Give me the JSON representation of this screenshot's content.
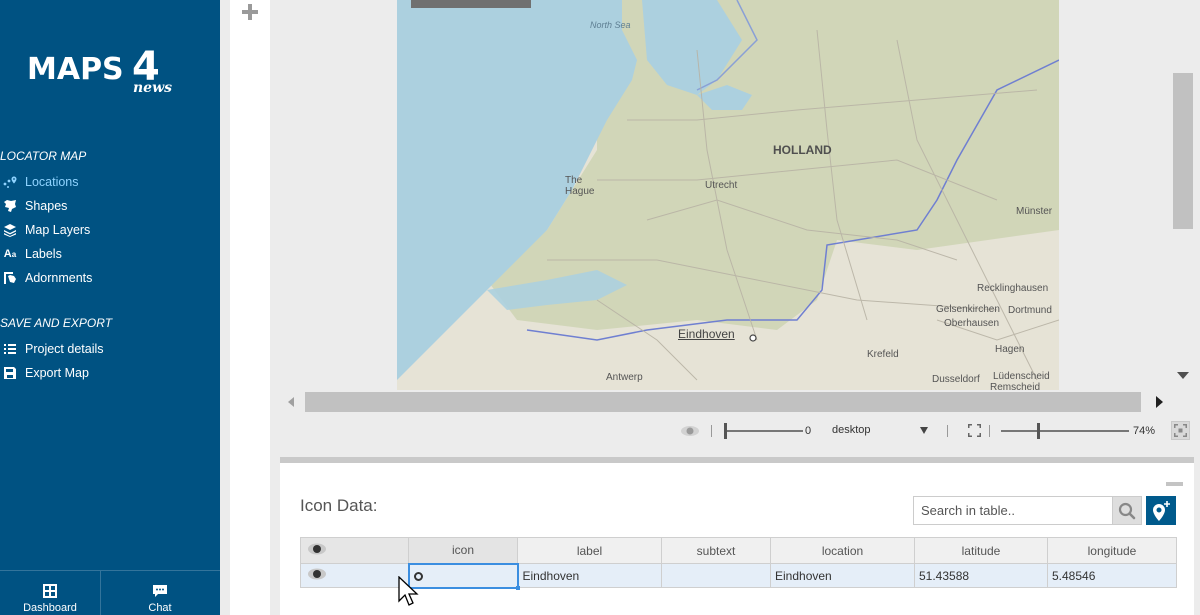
{
  "brand": {
    "main": "MAPS",
    "four": "4",
    "sub": "news"
  },
  "sidebar": {
    "sections": [
      {
        "title": "LOCATOR MAP",
        "items": [
          {
            "label": "Locations",
            "icon": "locations-icon",
            "active": true
          },
          {
            "label": "Shapes",
            "icon": "shapes-icon"
          },
          {
            "label": "Map Layers",
            "icon": "layers-icon"
          },
          {
            "label": "Labels",
            "icon": "labels-icon"
          },
          {
            "label": "Adornments",
            "icon": "adornments-icon"
          }
        ]
      },
      {
        "title": "SAVE AND EXPORT",
        "items": [
          {
            "label": "Project details",
            "icon": "list-icon"
          },
          {
            "label": "Export Map",
            "icon": "save-icon"
          }
        ]
      }
    ],
    "bottom": [
      {
        "label": "Dashboard",
        "icon": "dashboard-icon"
      },
      {
        "label": "Chat",
        "icon": "chat-icon"
      }
    ]
  },
  "map": {
    "labels": {
      "north_sea": "North Sea",
      "holland": "HOLLAND",
      "the": "The",
      "hague": "Hague",
      "utrecht": "Utrecht",
      "munster": "Münster",
      "recklinghausen": "Recklinghausen",
      "gelsenkirchen": "Gelsenkirchen",
      "dortmund": "Dortmund",
      "oberhausen": "Oberhausen",
      "eindhoven": "Eindhoven",
      "krefeld": "Krefeld",
      "hagen": "Hagen",
      "antwerp": "Antwerp",
      "dusseldorf": "Dusseldorf",
      "ludenscheid": "Lüdenscheid",
      "remscheid": "Remscheid"
    }
  },
  "toolbar": {
    "slider_value": "0",
    "device": "desktop",
    "zoom": "74%"
  },
  "panel": {
    "title": "Icon Data:",
    "search_placeholder": "Search in table..",
    "columns": [
      "icon",
      "label",
      "subtext",
      "location",
      "latitude",
      "longitude"
    ],
    "rows": [
      {
        "icon": "",
        "label": "Eindhoven",
        "subtext": "",
        "location": "Eindhoven",
        "latitude": "51.43588",
        "longitude": "5.48546"
      }
    ]
  },
  "colors": {
    "sidebar": "#005282",
    "accent": "#005a8c",
    "active_nav": "#8fd3ff",
    "sea": "#acd0df"
  }
}
